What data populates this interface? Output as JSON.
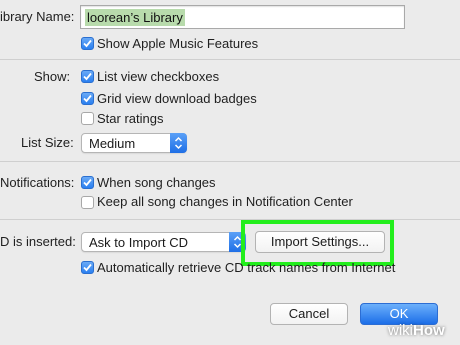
{
  "library": {
    "label": "ibrary Name:",
    "value": "loorean’s Library",
    "show_apple_music": "Show Apple Music Features"
  },
  "show": {
    "label": "Show:",
    "options": [
      {
        "label": "List view checkboxes",
        "checked": true
      },
      {
        "label": "Grid view download badges",
        "checked": true
      },
      {
        "label": "Star ratings",
        "checked": false
      }
    ]
  },
  "list_size": {
    "label": "List Size:",
    "value": "Medium"
  },
  "notifications": {
    "label": "Notifications:",
    "options": [
      {
        "label": "When song changes",
        "checked": true
      },
      {
        "label": "Keep all song changes in Notification Center",
        "checked": false
      }
    ]
  },
  "cd": {
    "label": "D is inserted:",
    "value": "Ask to Import CD",
    "import_settings": "Import Settings...",
    "auto_retrieve": "Automatically retrieve CD track names from Internet"
  },
  "footer": {
    "cancel": "Cancel",
    "ok": "OK"
  },
  "watermark": {
    "part1": "wiki",
    "part2": "How"
  },
  "colors": {
    "accent": "#2a7ff0",
    "highlight": "#22ee1c",
    "text_selection": "#b8dbac"
  }
}
